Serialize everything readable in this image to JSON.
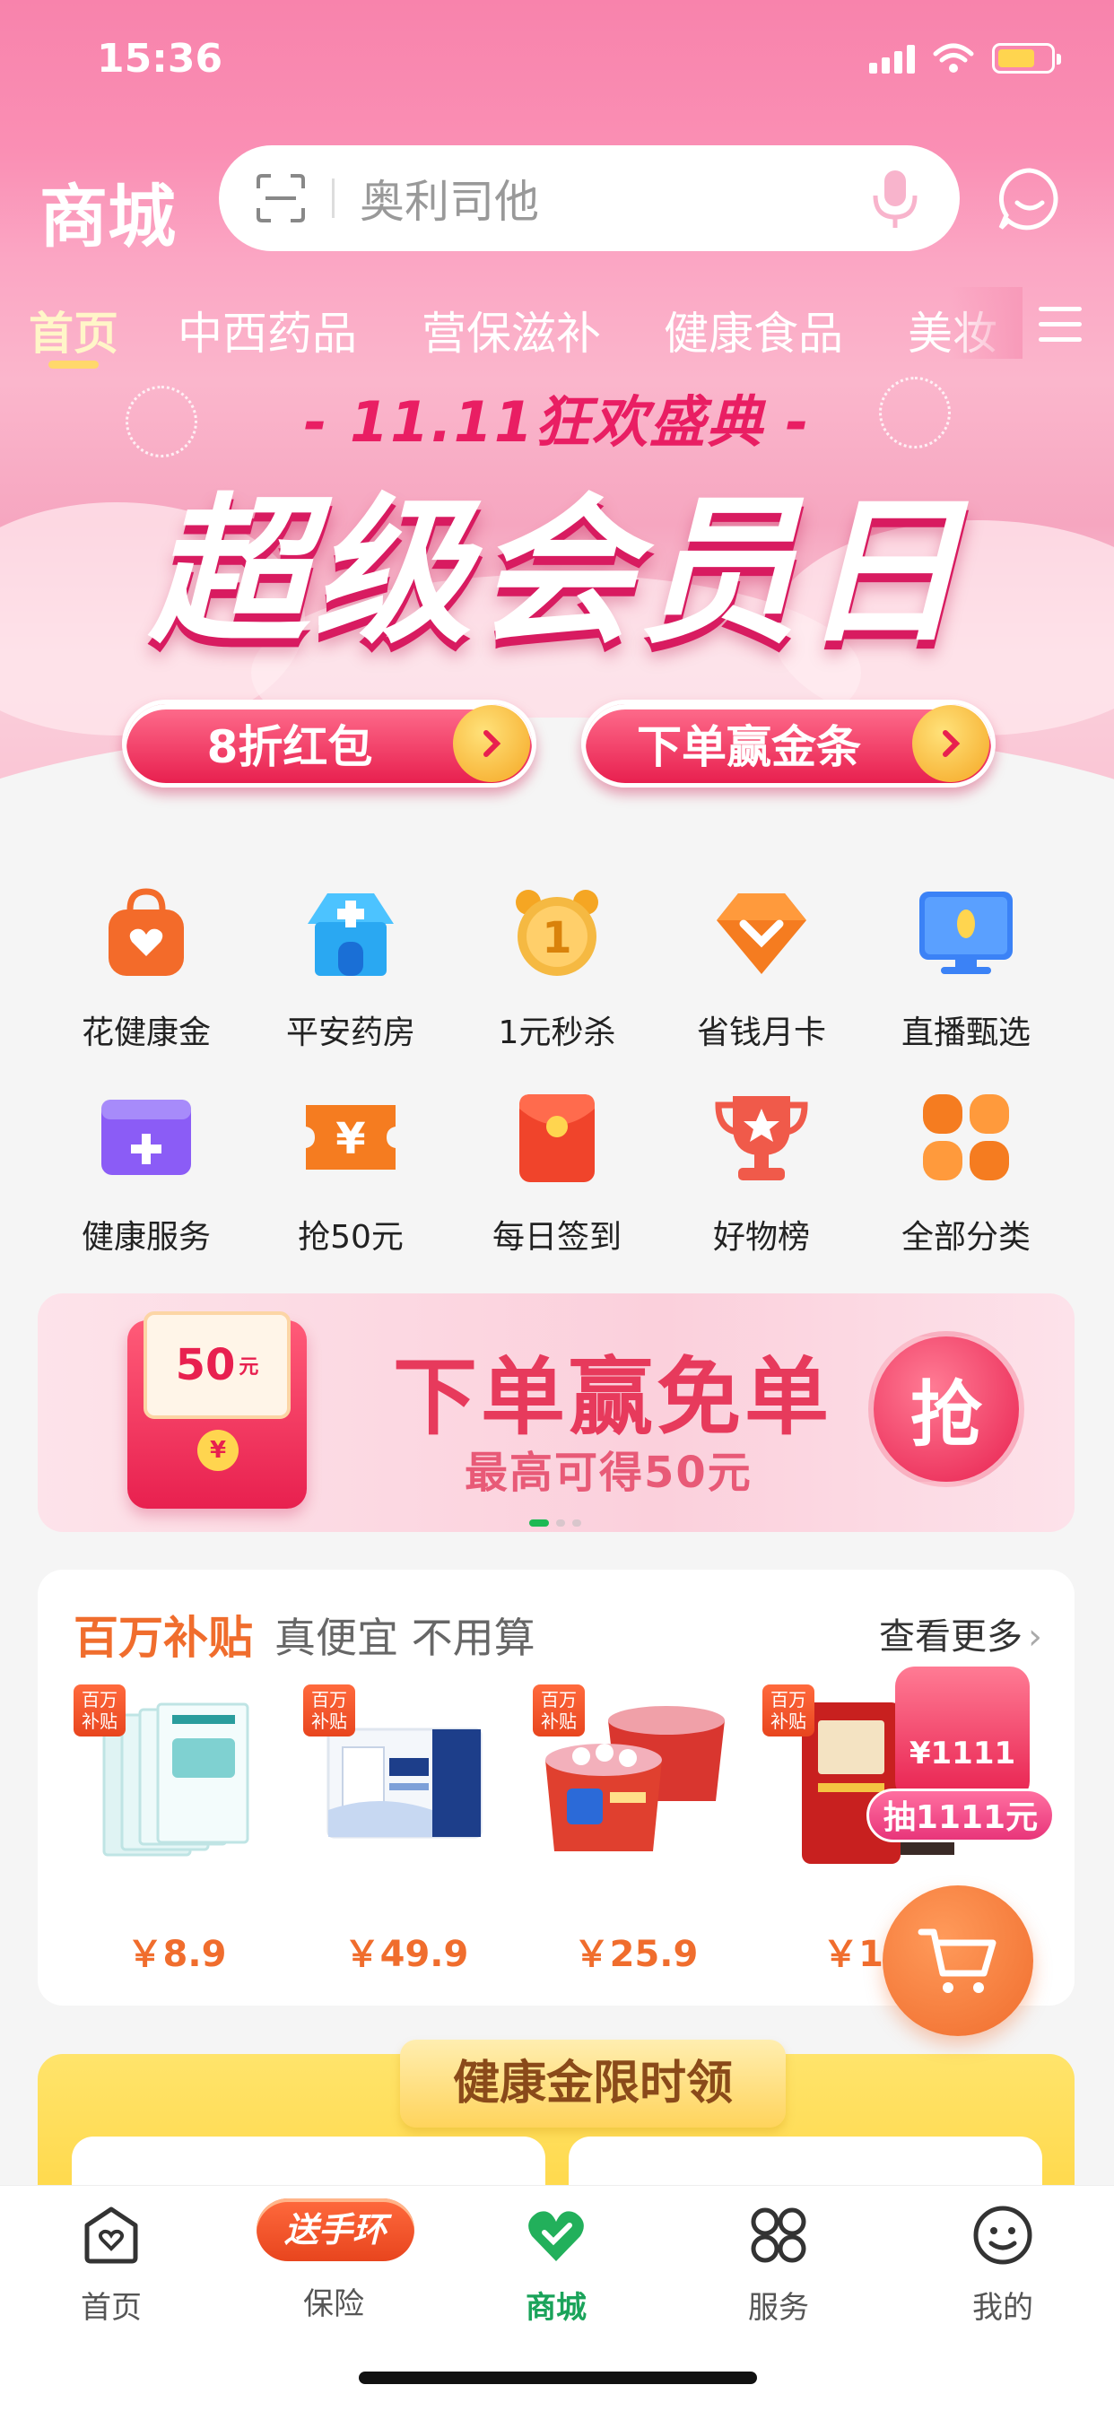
{
  "status": {
    "time": "15:36"
  },
  "header": {
    "brand": "商城",
    "search_placeholder": "奥利司他"
  },
  "tabs": [
    {
      "label": "首页",
      "active": true
    },
    {
      "label": "中西药品"
    },
    {
      "label": "营保滋补"
    },
    {
      "label": "健康食品"
    },
    {
      "label": "美妆"
    }
  ],
  "banner": {
    "subtitle": "- 11.11狂欢盛典 -",
    "title": "超级会员日",
    "buttons": [
      {
        "label": "8折红包"
      },
      {
        "label": "下单赢金条"
      }
    ]
  },
  "grid": [
    {
      "label": "花健康金",
      "icon": "heart-bag-icon",
      "color": "#f36b2a"
    },
    {
      "label": "平安药房",
      "icon": "pharmacy-icon",
      "color": "#2aa8f2"
    },
    {
      "label": "1元秒杀",
      "icon": "alarm-clock-icon",
      "color": "#f5a623"
    },
    {
      "label": "省钱月卡",
      "icon": "diamond-icon",
      "color": "#f57c20"
    },
    {
      "label": "直播甄选",
      "icon": "monitor-icon",
      "color": "#3b82f6"
    },
    {
      "label": "健康服务",
      "icon": "medical-card-icon",
      "color": "#8b5cf6"
    },
    {
      "label": "抢50元",
      "icon": "coupon-icon",
      "color": "#f57c20"
    },
    {
      "label": "每日签到",
      "icon": "red-envelope-icon",
      "color": "#f0442b"
    },
    {
      "label": "好物榜",
      "icon": "trophy-icon",
      "color": "#f05a4a"
    },
    {
      "label": "全部分类",
      "icon": "clover-icon",
      "color": "#f57c20"
    }
  ],
  "promo": {
    "card_value": "50",
    "card_unit": "元",
    "title": "下单赢免单",
    "subtitle": "最高可得50元",
    "grab": "抢"
  },
  "subsidy": {
    "title": "百万补贴",
    "subtitle": "真便宜 不用算",
    "more": "查看更多",
    "badge": "百万补贴",
    "products": [
      {
        "name": "mask-pack",
        "price": "￥8.9"
      },
      {
        "name": "milk-box",
        "price": "￥49.9"
      },
      {
        "name": "hotpot-box",
        "price": "￥25.9"
      },
      {
        "name": "rice-bag",
        "price": "￥15"
      }
    ]
  },
  "lucky": {
    "amount": "¥1111",
    "label": "抽1111元"
  },
  "gold": {
    "title": "健康金限时领"
  },
  "nav": [
    {
      "label": "首页",
      "icon": "home-icon"
    },
    {
      "label": "保险",
      "icon": "insurance-icon",
      "pill": "送手环"
    },
    {
      "label": "商城",
      "icon": "mall-heart-icon",
      "active": true
    },
    {
      "label": "服务",
      "icon": "services-icon"
    },
    {
      "label": "我的",
      "icon": "profile-icon"
    }
  ]
}
